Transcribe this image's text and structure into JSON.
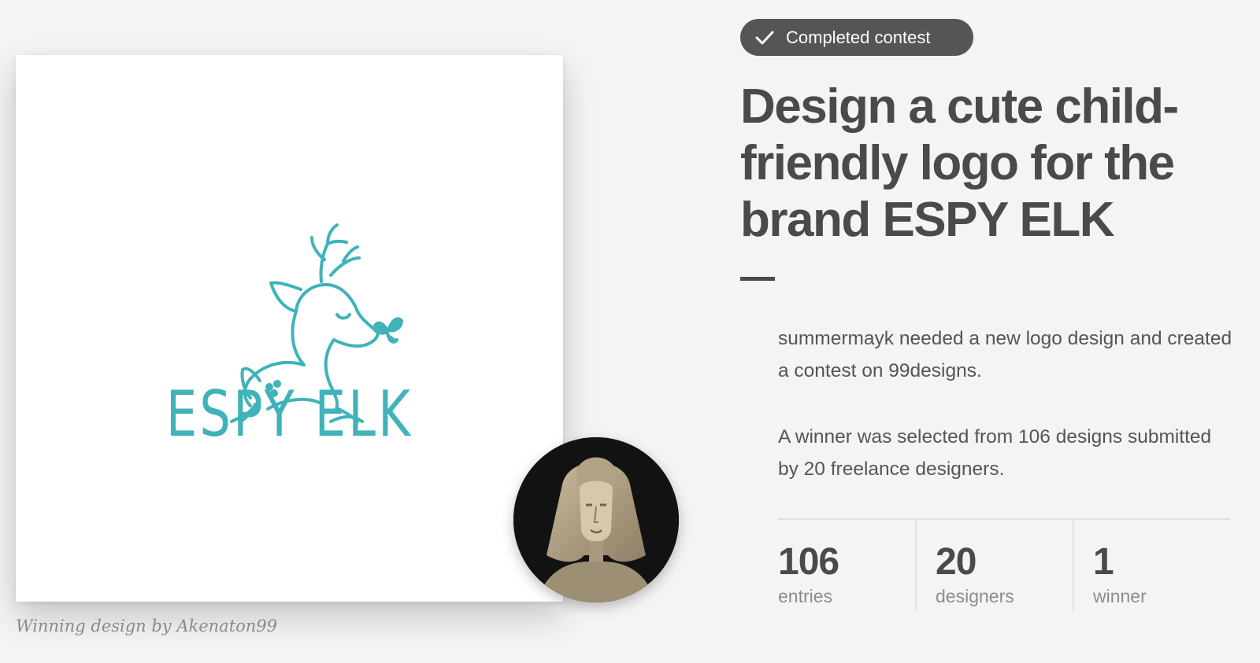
{
  "badge": {
    "label": "Completed contest",
    "icon": "check-icon"
  },
  "title": "Design a cute child-friendly logo for the brand ESPY ELK",
  "description": {
    "p1": "summermayk needed a new logo design and created a contest on 99designs.",
    "p2": "A winner was selected from 106 designs submitted by 20 freelance designers."
  },
  "stats": [
    {
      "value": "106",
      "label": "entries"
    },
    {
      "value": "20",
      "label": "designers"
    },
    {
      "value": "1",
      "label": "winner"
    }
  ],
  "design": {
    "logo_text": "ESPY ELK",
    "caption": "Winning design by Akenaton99",
    "accent_color": "#3fb3b9"
  },
  "avatar": {
    "icon": "pharaoh-bust-avatar"
  }
}
